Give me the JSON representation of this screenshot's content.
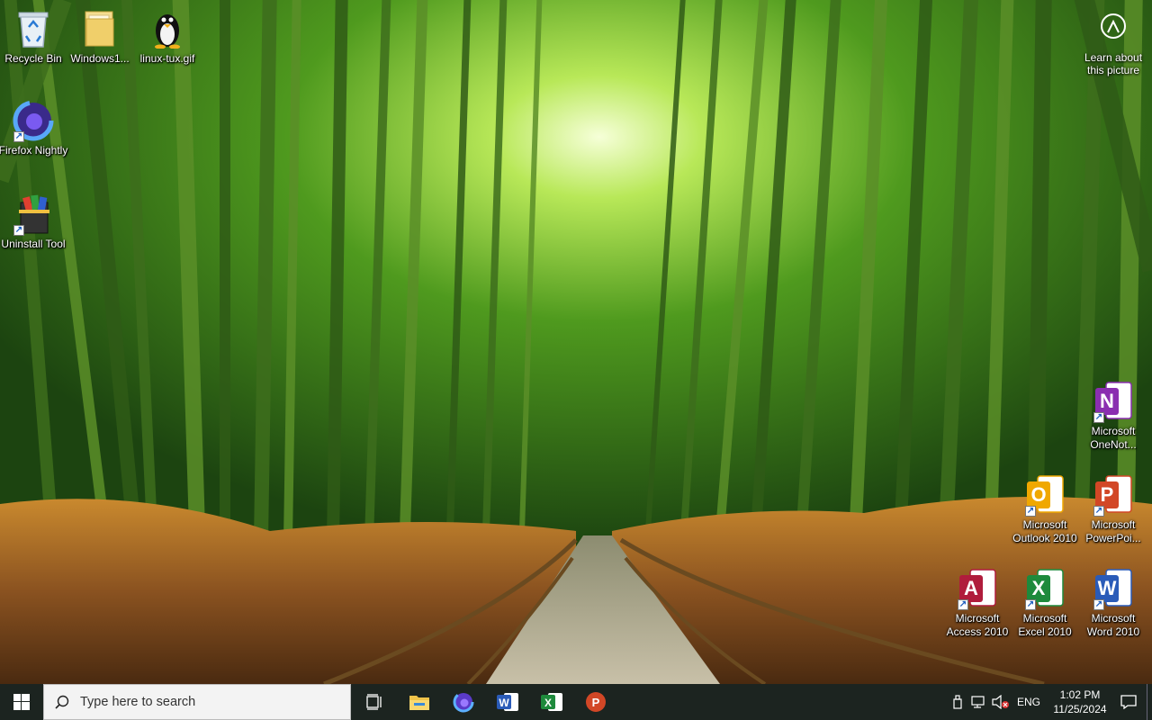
{
  "desktop": {
    "left_icons": [
      {
        "label": "Recycle Bin",
        "icon": "recycle-bin-icon"
      },
      {
        "label": "Windows1...",
        "icon": "folder-icon"
      },
      {
        "label": "linux-tux.gif",
        "icon": "tux-penguin-icon"
      },
      {
        "label": "Firefox Nightly",
        "icon": "firefox-nightly-icon"
      },
      {
        "label": "Uninstall Tool",
        "icon": "uninstall-tool-icon"
      }
    ],
    "right_icons": [
      {
        "label": "Microsoft OneNot...",
        "icon": "onenote-icon",
        "letter": "N",
        "color": "#8a2eb0"
      },
      {
        "label": "Microsoft Outlook 2010",
        "icon": "outlook-icon",
        "letter": "O",
        "color": "#f0a800"
      },
      {
        "label": "Microsoft PowerPoi...",
        "icon": "powerpoint-icon",
        "letter": "P",
        "color": "#d24726"
      },
      {
        "label": "Microsoft Access 2010",
        "icon": "access-icon",
        "letter": "A",
        "color": "#b01c3c"
      },
      {
        "label": "Microsoft Excel 2010",
        "icon": "excel-icon",
        "letter": "X",
        "color": "#1e8a3c"
      },
      {
        "label": "Microsoft Word 2010",
        "icon": "word-icon",
        "letter": "W",
        "color": "#2a5bb8"
      }
    ],
    "learn_about": {
      "label": "Learn about this picture",
      "icon": "camera-icon"
    }
  },
  "taskbar": {
    "search_placeholder": "Type here to search",
    "pinned": [
      {
        "name": "task-view-button",
        "icon": "task-view-icon"
      },
      {
        "name": "file-explorer-button",
        "icon": "file-explorer-icon"
      },
      {
        "name": "firefox-button",
        "icon": "firefox-icon"
      },
      {
        "name": "word-button",
        "icon": "word-icon",
        "letter": "W",
        "color": "#2a5bb8"
      },
      {
        "name": "excel-button",
        "icon": "excel-icon",
        "letter": "X",
        "color": "#1e8a3c"
      },
      {
        "name": "powerpoint-button",
        "icon": "powerpoint-icon",
        "letter": "P",
        "color": "#d24726"
      }
    ],
    "tray": {
      "language": "ENG",
      "time": "1:02 PM",
      "date": "11/25/2024"
    }
  }
}
